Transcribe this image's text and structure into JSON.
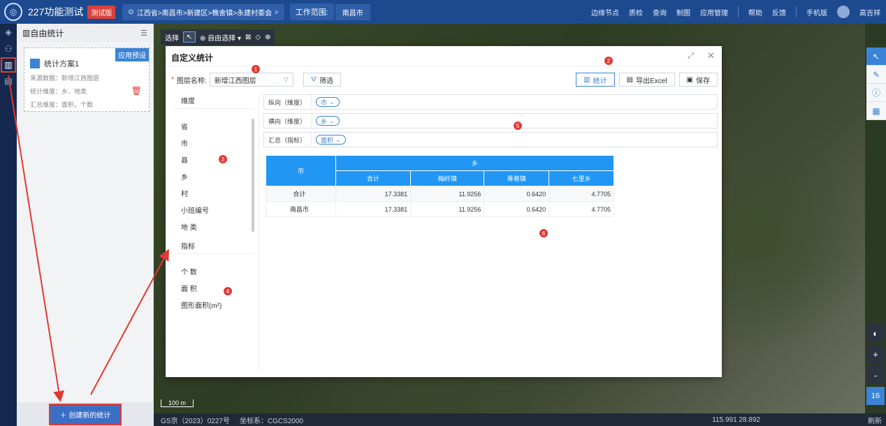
{
  "topbar": {
    "app_title": "227功能测试",
    "badge": "测试版",
    "location": "江西省>南昌市>新建区>樵舍镇>永建村委会",
    "work_range_label": "工作范围:",
    "work_range_value": "南昌市",
    "menu": [
      "边缘节点",
      "质检",
      "查询",
      "制图",
      "应用管理",
      "帮助",
      "反馈",
      "手机版"
    ],
    "user": "高吉祥"
  },
  "sidebar": {
    "title": "自由统计",
    "plan": {
      "preset_label": "应用预设",
      "name": "统计方案1",
      "source": "来源数据：新增江西图层",
      "dims": "统计维度：乡，地类",
      "summary": "汇总维度：面积，个数"
    },
    "create_button": "创建新的统计"
  },
  "map": {
    "toolbar_label": "选择",
    "free_select": "自由选择",
    "scale": "100 m",
    "footer_left": "GS京（2023）0227号",
    "footer_crs": "坐标系：CGCS2000",
    "coords": "115.991  28.892",
    "refresh": "刷新",
    "zoom_in": "+",
    "zoom_out": "-",
    "zoom_level": "16"
  },
  "modal": {
    "title": "自定义统计",
    "layer_label": "图层名称:",
    "layer_value": "新增江西图层",
    "filter_button": "筛选",
    "stat_button": "统计",
    "export_button": "导出Excel",
    "save_button": "保存",
    "dim_header": "维度",
    "dims": [
      "省",
      "市",
      "县",
      "乡",
      "村",
      "小班编号",
      "地 类"
    ],
    "metric_header": "指标",
    "metrics": [
      "个 数",
      "面 积",
      "图形面积(m²)"
    ],
    "rows": [
      {
        "label": "纵向（维度）",
        "chip": "市"
      },
      {
        "label": "横向（维度）",
        "chip": "乡"
      },
      {
        "label": "汇总（指标）",
        "chip": "面积"
      }
    ],
    "table": {
      "corner": "市",
      "group": "乡",
      "columns": [
        "合计",
        "梅岭镇",
        "蒋巷镇",
        "七里乡"
      ],
      "body": [
        {
          "label": "合计",
          "values": [
            "17.3381",
            "11.9256",
            "0.6420",
            "4.7705"
          ]
        },
        {
          "label": "南昌市",
          "values": [
            "17.3381",
            "11.9256",
            "0.6420",
            "4.7705"
          ]
        }
      ]
    },
    "markers": [
      "1",
      "2",
      "3",
      "4",
      "5",
      "6"
    ]
  },
  "colors": {
    "accent": "#3b83d6",
    "header_bg": "#1d4a8f",
    "danger": "#e03a34",
    "table_head": "#2196f3"
  }
}
